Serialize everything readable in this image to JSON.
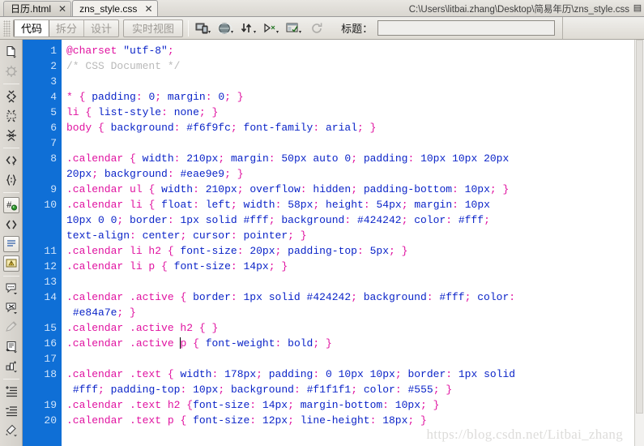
{
  "window": {
    "file_path": "C:\\Users\\litbai.zhang\\Desktop\\简易年历\\zns_style.css",
    "watermark": "https://blog.csdn.net/Litbai_zhang"
  },
  "tabs": [
    {
      "label": "日历.html",
      "close": "✕",
      "active": false
    },
    {
      "label": "zns_style.css",
      "close": "✕",
      "active": true
    }
  ],
  "tabbar": {
    "dropdown_icon": "▤"
  },
  "toolbar": {
    "view_buttons": [
      {
        "label": "代码",
        "active": true
      },
      {
        "label": "拆分",
        "active": false
      },
      {
        "label": "设计",
        "active": false
      }
    ],
    "live_view_label": "实时视图",
    "icons": [
      {
        "name": "multiscreen-preview-icon",
        "disabled": false
      },
      {
        "name": "browser-preview-icon",
        "disabled": false
      },
      {
        "name": "file-management-icon",
        "disabled": false
      },
      {
        "name": "validation-icon",
        "disabled": false
      },
      {
        "name": "visual-aids-icon",
        "disabled": false
      },
      {
        "name": "refresh-icon",
        "disabled": true
      }
    ],
    "title_label": "标题：",
    "title_value": "",
    "title_placeholder": ""
  },
  "rail": {
    "icons": [
      {
        "name": "open-documents-icon",
        "dim": false,
        "boxed": false
      },
      {
        "name": "format-source-icon",
        "dim": true,
        "boxed": false
      },
      {
        "name": "collapse-full-tag-icon",
        "dim": false,
        "boxed": false
      },
      {
        "name": "collapse-selection-icon",
        "dim": false,
        "boxed": false
      },
      {
        "name": "expand-all-icon",
        "dim": false,
        "boxed": false
      },
      {
        "name": "select-parent-tag-icon",
        "dim": false,
        "boxed": false
      },
      {
        "name": "balance-braces-icon",
        "dim": false,
        "boxed": false
      },
      {
        "name": "line-numbers-icon",
        "dim": false,
        "boxed": true
      },
      {
        "name": "highlight-invalid-code-icon",
        "dim": false,
        "boxed": false
      },
      {
        "name": "word-wrap-icon",
        "dim": false,
        "boxed": false
      },
      {
        "name": "syntax-error-alerts-icon",
        "dim": false,
        "boxed": true
      },
      {
        "name": "apply-comment-icon",
        "dim": false,
        "boxed": false
      },
      {
        "name": "remove-comment-icon",
        "dim": false,
        "boxed": false
      },
      {
        "name": "wrap-tag-icon",
        "dim": true,
        "boxed": false
      },
      {
        "name": "recent-snippets-icon",
        "dim": false,
        "boxed": false
      },
      {
        "name": "move-css-rules-icon",
        "dim": false,
        "boxed": false
      },
      {
        "name": "indent-code-icon",
        "dim": false,
        "boxed": false
      },
      {
        "name": "outdent-code-icon",
        "dim": false,
        "boxed": false
      },
      {
        "name": "format-source-code-icon",
        "dim": false,
        "boxed": false
      }
    ]
  },
  "editor": {
    "language": "css",
    "line_numbers": [
      1,
      2,
      3,
      4,
      5,
      6,
      7,
      8,
      "",
      9,
      10,
      "",
      "",
      11,
      12,
      13,
      14,
      "",
      15,
      16,
      17,
      18,
      "",
      19,
      20
    ],
    "lines": [
      {
        "num": 1,
        "text": "@charset \"utf-8\";"
      },
      {
        "num": 2,
        "text": "/* CSS Document */"
      },
      {
        "num": 3,
        "text": ""
      },
      {
        "num": 4,
        "text": "* { padding: 0; margin: 0; }"
      },
      {
        "num": 5,
        "text": "li { list-style: none; }"
      },
      {
        "num": 6,
        "text": "body { background: #f6f9fc; font-family: arial; }"
      },
      {
        "num": 7,
        "text": ""
      },
      {
        "num": 8,
        "text": ".calendar { width: 210px; margin: 50px auto 0; padding: 10px 10px 20px 20px; background: #eae9e9; }"
      },
      {
        "num": 9,
        "text": ".calendar ul { width: 210px; overflow: hidden; padding-bottom: 10px; }"
      },
      {
        "num": 10,
        "text": ".calendar li { float: left; width: 58px; height: 54px; margin: 10px 10px 0 0; border: 1px solid #fff; background: #424242; color: #fff; text-align: center; cursor: pointer; }"
      },
      {
        "num": 11,
        "text": ".calendar li h2 { font-size: 20px; padding-top: 5px; }"
      },
      {
        "num": 12,
        "text": ".calendar li p { font-size: 14px; }"
      },
      {
        "num": 13,
        "text": ""
      },
      {
        "num": 14,
        "text": ".calendar .active { border: 1px solid #424242; background: #fff; color: #e84a7e; }"
      },
      {
        "num": 15,
        "text": ".calendar .active h2 { }"
      },
      {
        "num": 16,
        "text": ".calendar .active p { font-weight: bold; }"
      },
      {
        "num": 17,
        "text": ""
      },
      {
        "num": 18,
        "text": ".calendar .text { width: 178px; padding: 0 10px 10px; border: 1px solid #fff; padding-top: 10px; background: #f1f1f1; color: #555; }"
      },
      {
        "num": 19,
        "text": ".calendar .text h2 {font-size: 14px; margin-bottom: 10px; }"
      },
      {
        "num": 20,
        "text": ".calendar .text p { font-size: 12px; line-height: 18px; }"
      }
    ],
    "cursor": {
      "line": 16,
      "before_token": "p"
    }
  },
  "colors": {
    "gutter_bg": "#0f6fd6",
    "gutter_fg": "#cfe4fb",
    "selector": "#e012a0",
    "property": "#0b24c8",
    "comment": "#b9b9b9",
    "editor_bg": "#ffffff",
    "chrome_bg": "#d6d3ce",
    "accent_active_tab": "#f2f0ec"
  }
}
